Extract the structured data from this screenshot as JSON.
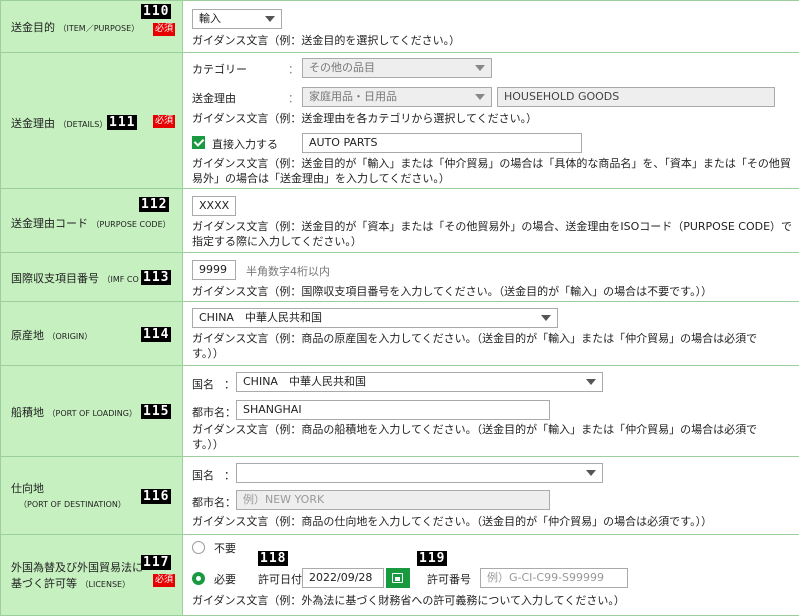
{
  "required_label": "必須",
  "items": {
    "purpose": {
      "num": "110",
      "label": "送金目的",
      "label_sub": "（ITEM／PURPOSE）",
      "select_value": "輸入",
      "guide": "ガイダンス文言（例：送金目的を選択してください。）"
    },
    "details": {
      "num": "111",
      "label": "送金理由",
      "label_sub": "（DETAILS）",
      "category_label": "カテゴリー",
      "colon": "：",
      "category_value": "その他の品目",
      "reason_label": "送金理由",
      "reason_value": "家庭用品・日用品",
      "reason_en": "HOUSEHOLD GOODS",
      "guide1": "ガイダンス文言（例：送金理由を各カテゴリから選択してください。）",
      "direct_label": "直接入力する",
      "direct_value": "AUTO PARTS",
      "guide2": "ガイダンス文言（例：送金目的が「輸入」または「仲介貿易」の場合は「具体的な商品名」を、「資本」または「その他貿易外」の場合は「送金理由」を入力してください。）"
    },
    "purpose_code": {
      "num": "112",
      "label": "送金理由コード",
      "label_sub": "（PURPOSE CODE）",
      "value": "XXXX",
      "guide": "ガイダンス文言（例：送金目的が「資本」または「その他貿易外」の場合、送金理由をISOコード（PURPOSE CODE）で指定する際に入力してください。）"
    },
    "imf_code": {
      "num": "113",
      "label": "国際収支項目番号",
      "label_sub": "（IMF CO",
      "value": "9999",
      "hint": "半角数字4桁以内",
      "guide": "ガイダンス文言（例：国際収支項目番号を入力してください。（送金目的が「輸入」の場合は不要です。））"
    },
    "origin": {
      "num": "114",
      "label": "原産地",
      "label_sub": "（ORIGIN）",
      "select_value": "CHINA　中華人民共和国",
      "guide": "ガイダンス文言（例：商品の原産国を入力してください。（送金目的が「輸入」または「仲介貿易」の場合は必須です。））"
    },
    "loading": {
      "num": "115",
      "label": "船積地",
      "label_sub": "（PORT OF LOADING）",
      "country_label": "国名",
      "colon": "：",
      "country_value": "CHINA　中華人民共和国",
      "city_label": "都市名：",
      "city_value": "SHANGHAI",
      "guide": "ガイダンス文言（例：商品の船積地を入力してください。（送金目的が「輸入」または「仲介貿易」の場合は必須です。））"
    },
    "destination": {
      "num": "116",
      "label": "仕向地",
      "label_sub": "（PORT OF DESTINATION）",
      "country_label": "国名",
      "colon": "：",
      "country_value": "",
      "city_label": "都市名：",
      "city_placeholder": "例）NEW YORK",
      "guide": "ガイダンス文言（例：商品の仕向地を入力してください。（送金目的が「仲介貿易」の場合は必須です。））"
    },
    "license": {
      "num": "117",
      "label1": "外国為替及び外国貿易法に",
      "label2": "基づく許可等",
      "label_sub": "（LICENSE）",
      "option_no": "不要",
      "option_yes": "必要",
      "date_num": "118",
      "date_label": "許可日付",
      "date_value": "2022/09/28",
      "permit_num": "119",
      "permit_label": "許可番号",
      "permit_placeholder": "例）G-CI-C99-S99999",
      "guide": "ガイダンス文言（例：外為法に基づく財務省への許可義務について入力してください。）"
    }
  },
  "colors": {
    "label_bg": "#c6f0c0",
    "border": "#9ccf9c",
    "accent": "#1a9a40",
    "required": "#e60000"
  }
}
